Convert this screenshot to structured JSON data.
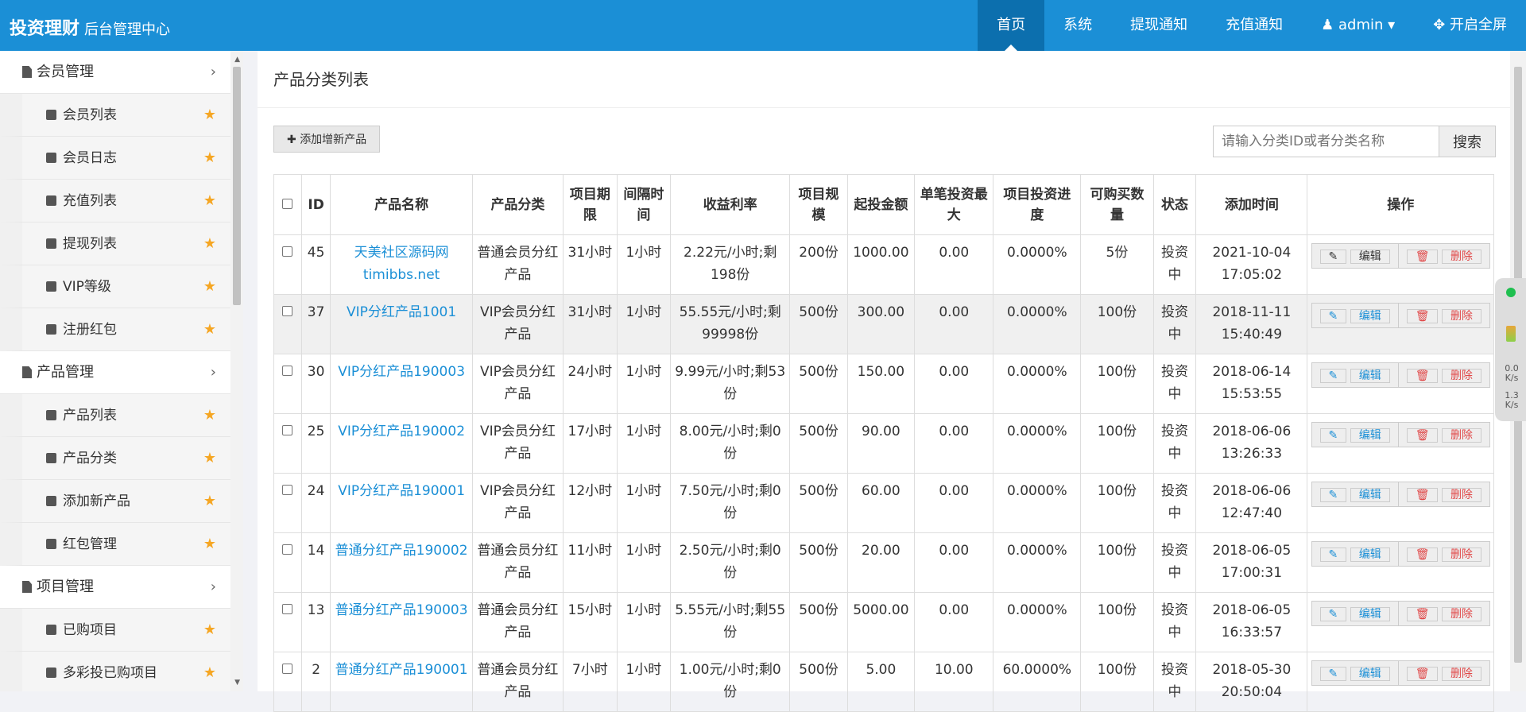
{
  "header": {
    "brand": "投资理财",
    "subtitle": "后台管理中心",
    "nav": [
      "首页",
      "系统",
      "提现通知",
      "充值通知",
      "admin",
      "开启全屏"
    ]
  },
  "sidebar": {
    "groups": [
      {
        "title": "会员管理",
        "items": [
          "会员列表",
          "会员日志",
          "充值列表",
          "提现列表",
          "VIP等级",
          "注册红包"
        ]
      },
      {
        "title": "产品管理",
        "items": [
          "产品列表",
          "产品分类",
          "添加新产品",
          "红包管理"
        ]
      },
      {
        "title": "项目管理",
        "items": [
          "已购项目",
          "多彩投已购项目"
        ]
      }
    ]
  },
  "page": {
    "title": "产品分类列表",
    "add_button": "添加增新产品",
    "search_placeholder": "请输入分类ID或者分类名称",
    "search_button": "搜索"
  },
  "table": {
    "headers": [
      "ID",
      "产品名称",
      "产品分类",
      "项目期限",
      "间隔时间",
      "收益利率",
      "项目规模",
      "起投金额",
      "单笔投资最大",
      "项目投资进度",
      "可购买数量",
      "状态",
      "添加时间",
      "操作"
    ],
    "rows": [
      {
        "id": "45",
        "name": "天美社区源码网timibbs.net",
        "category": "普通会员分红产品",
        "term": "31小时",
        "interval": "1小时",
        "rate": "2.22元/小时;剩198份",
        "scale": "200份",
        "min": "1000.00",
        "max": "0.00",
        "progress": "0.0000%",
        "qty": "5份",
        "status": "投资中",
        "time": "2021-10-04 17:05:02"
      },
      {
        "id": "37",
        "name": "VIP分红产品1001",
        "category": "VIP会员分红产品",
        "term": "31小时",
        "interval": "1小时",
        "rate": "55.55元/小时;剩99998份",
        "scale": "500份",
        "min": "300.00",
        "max": "0.00",
        "progress": "0.0000%",
        "qty": "100份",
        "status": "投资中",
        "time": "2018-11-11 15:40:49"
      },
      {
        "id": "30",
        "name": "VIP分红产品190003",
        "category": "VIP会员分红产品",
        "term": "24小时",
        "interval": "1小时",
        "rate": "9.99元/小时;剩53份",
        "scale": "500份",
        "min": "150.00",
        "max": "0.00",
        "progress": "0.0000%",
        "qty": "100份",
        "status": "投资中",
        "time": "2018-06-14 15:53:55"
      },
      {
        "id": "25",
        "name": "VIP分红产品190002",
        "category": "VIP会员分红产品",
        "term": "17小时",
        "interval": "1小时",
        "rate": "8.00元/小时;剩0份",
        "scale": "500份",
        "min": "90.00",
        "max": "0.00",
        "progress": "0.0000%",
        "qty": "100份",
        "status": "投资中",
        "time": "2018-06-06 13:26:33"
      },
      {
        "id": "24",
        "name": "VIP分红产品190001",
        "category": "VIP会员分红产品",
        "term": "12小时",
        "interval": "1小时",
        "rate": "7.50元/小时;剩0份",
        "scale": "500份",
        "min": "60.00",
        "max": "0.00",
        "progress": "0.0000%",
        "qty": "100份",
        "status": "投资中",
        "time": "2018-06-06 12:47:40"
      },
      {
        "id": "14",
        "name": "普通分红产品190002",
        "category": "普通会员分红产品",
        "term": "11小时",
        "interval": "1小时",
        "rate": "2.50元/小时;剩0份",
        "scale": "500份",
        "min": "20.00",
        "max": "0.00",
        "progress": "0.0000%",
        "qty": "100份",
        "status": "投资中",
        "time": "2018-06-05 17:00:31"
      },
      {
        "id": "13",
        "name": "普通分红产品190003",
        "category": "普通会员分红产品",
        "term": "15小时",
        "interval": "1小时",
        "rate": "5.55元/小时;剩55份",
        "scale": "500份",
        "min": "5000.00",
        "max": "0.00",
        "progress": "0.0000%",
        "qty": "100份",
        "status": "投资中",
        "time": "2018-06-05 16:33:57"
      },
      {
        "id": "2",
        "name": "普通分红产品190001",
        "category": "普通会员分红产品",
        "term": "7小时",
        "interval": "1小时",
        "rate": "1.00元/小时;剩0份",
        "scale": "500份",
        "min": "5.00",
        "max": "10.00",
        "progress": "60.0000%",
        "qty": "100份",
        "status": "投资中",
        "time": "2018-05-30 20:50:04"
      }
    ],
    "edit_label": "编辑",
    "delete_label": "删除"
  },
  "widget": {
    "up": "0.0",
    "up_unit": "K/s",
    "down": "1.3",
    "down_unit": "K/s"
  }
}
